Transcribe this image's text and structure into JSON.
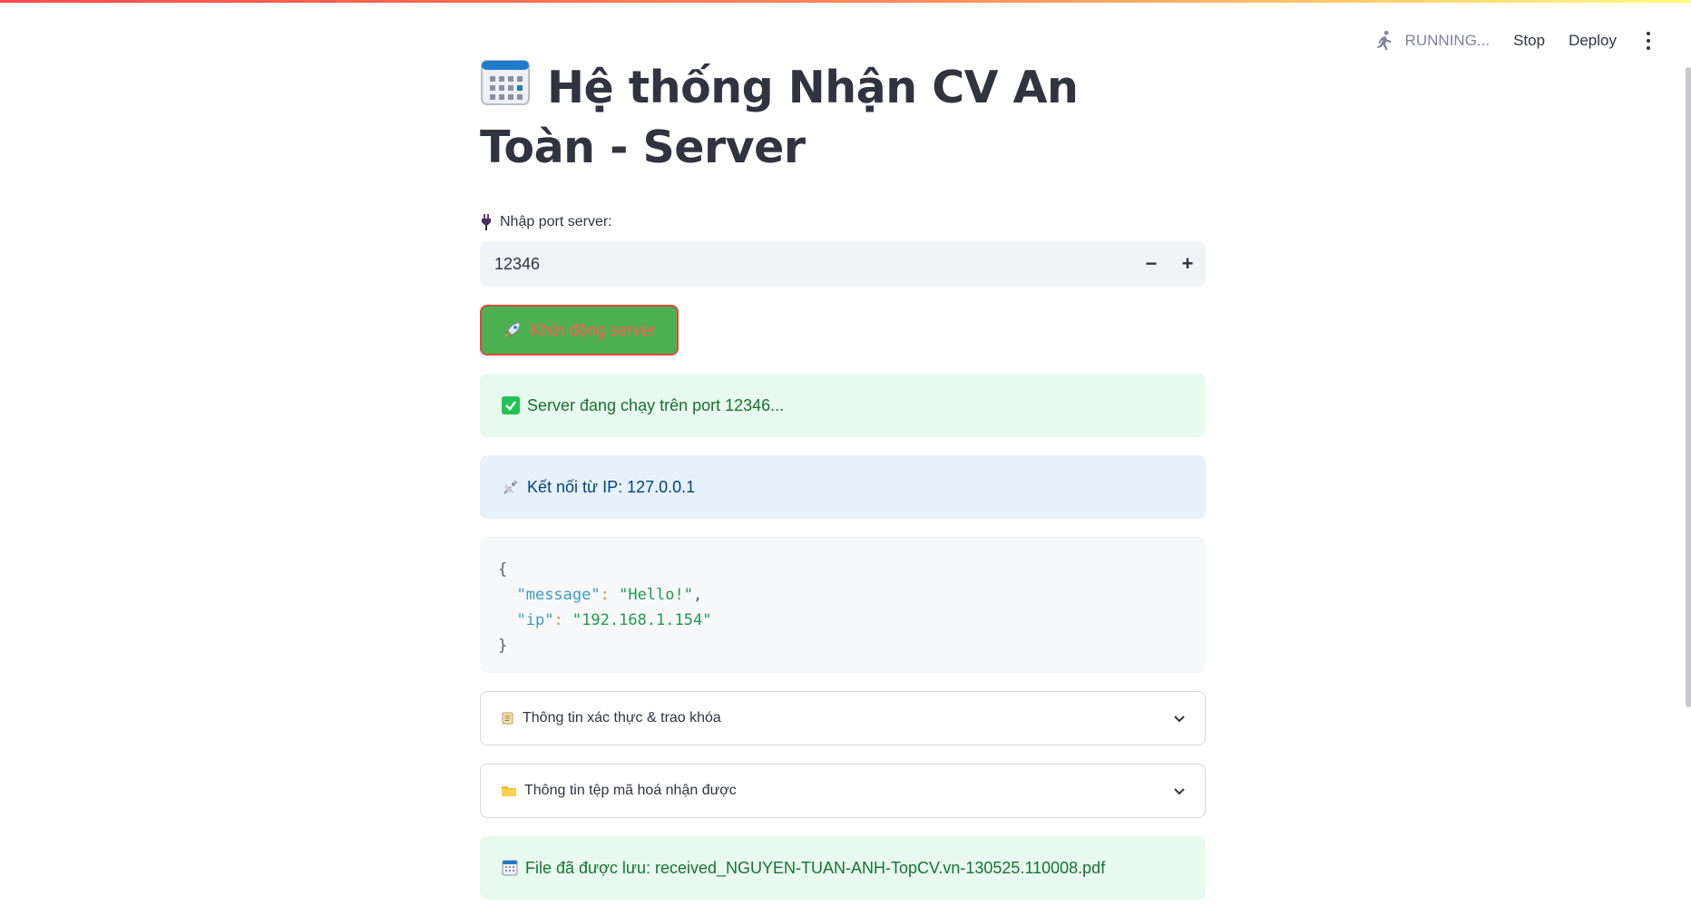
{
  "toolbar": {
    "status": "RUNNING...",
    "stop": "Stop",
    "deploy": "Deploy"
  },
  "page": {
    "title": "Hệ thống Nhận CV An Toàn - Server"
  },
  "port_input": {
    "label": "Nhập port server:",
    "value": "12346"
  },
  "start_button": {
    "label": "Khởi động server"
  },
  "alerts": {
    "running": "Server đang chạy trên port 12346...",
    "connection": "Kết nối từ IP: 127.0.0.1",
    "saved": "File đã được lưu: received_NGUYEN-TUAN-ANH-TopCV.vn-130525.110008.pdf"
  },
  "json_view": {
    "open": "{",
    "close": "}",
    "entries": [
      {
        "key": "\"message\"",
        "value": "\"Hello!\""
      },
      {
        "key": "\"ip\"",
        "value": "\"192.168.1.154\""
      }
    ]
  },
  "expanders": [
    {
      "label": "Thông tin xác thực & trao khóa",
      "icon": "scroll-icon"
    },
    {
      "label": "Thông tin tệp mã hoá nhận được",
      "icon": "folder-icon"
    }
  ],
  "colors": {
    "accent": "#ff4b4b",
    "button_bg": "#4caf50",
    "success_bg": "#e8f9ee",
    "info_bg": "#e7f1fc"
  }
}
